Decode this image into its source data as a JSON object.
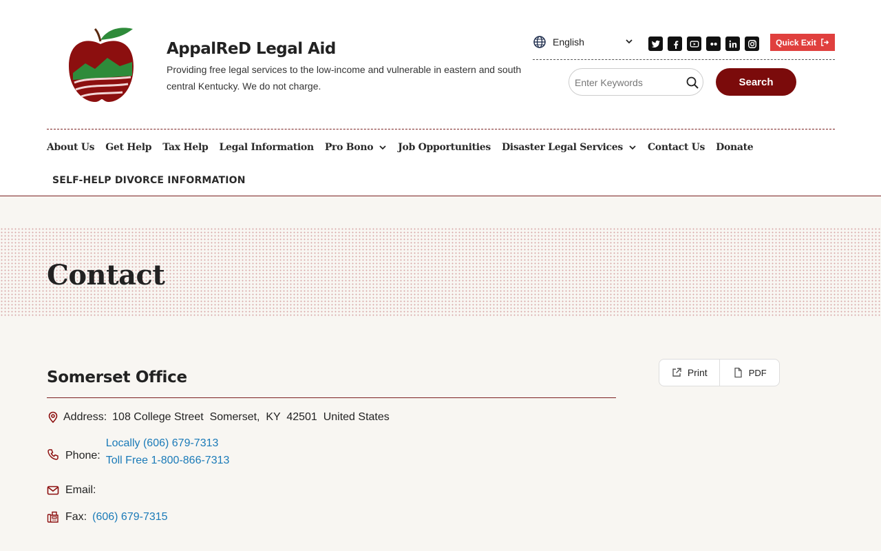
{
  "site": {
    "title": "AppalReD Legal Aid",
    "tagline": "Providing free legal services to the low-income and vulnerable in eastern and south central Kentucky. We do not charge.",
    "logo_icon": "apple-logo-icon"
  },
  "language": {
    "selected": "English"
  },
  "social": [
    "twitter-icon",
    "facebook-icon",
    "youtube-icon",
    "flickr-icon",
    "linkedin-icon",
    "instagram-icon"
  ],
  "quick_exit": {
    "label": "Quick Exit"
  },
  "search": {
    "placeholder": "Enter Keywords",
    "button_label": "Search"
  },
  "nav": {
    "items": [
      {
        "label": "About Us"
      },
      {
        "label": "Get Help"
      },
      {
        "label": "Tax Help"
      },
      {
        "label": "Legal Information"
      },
      {
        "label": "Pro Bono"
      },
      {
        "label": "Job Opportunities"
      },
      {
        "label": "Disaster Legal Services"
      },
      {
        "label": "Contact Us"
      },
      {
        "label": "Donate"
      }
    ],
    "secondary": "SELF-HELP DIVORCE INFORMATION"
  },
  "page": {
    "title": "Contact"
  },
  "tools": {
    "print": "Print",
    "pdf": "PDF"
  },
  "office": {
    "name": "Somerset Office",
    "address_label": "Address:",
    "address": "108 College Street  Somerset,  KY  42501  United States",
    "phone_label": "Phone:",
    "phone_local": "Locally (606) 679-7313",
    "phone_tollfree": "Toll Free 1-800-866-7313",
    "email_label": "Email:",
    "fax_label": "Fax:",
    "fax": "(606) 679-7315"
  },
  "colors": {
    "brand_red": "#7b0b0b",
    "quick_exit": "#e0403e",
    "link": "#1a7ab8",
    "page_bg": "#f8f6f2"
  }
}
